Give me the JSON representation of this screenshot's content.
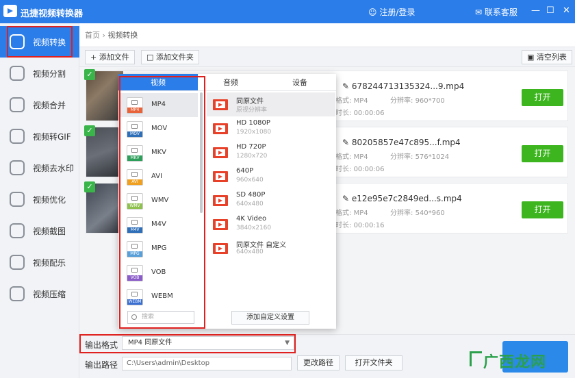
{
  "app": {
    "title": "迅捷视频转换器",
    "login": "注册/登录",
    "service": "联系客服",
    "win_min": "—",
    "win_max": "☐",
    "win_close": "✕"
  },
  "sidebar": {
    "items": [
      {
        "label": "视频转换",
        "icon": "convert-icon",
        "active": true
      },
      {
        "label": "视频分割",
        "icon": "split-icon"
      },
      {
        "label": "视频合并",
        "icon": "merge-icon"
      },
      {
        "label": "视频转GIF",
        "icon": "gif-icon"
      },
      {
        "label": "视频去水印",
        "icon": "watermark-remove-icon"
      },
      {
        "label": "视频优化",
        "icon": "optimize-icon"
      },
      {
        "label": "视频截图",
        "icon": "screenshot-icon"
      },
      {
        "label": "视频配乐",
        "icon": "music-icon"
      },
      {
        "label": "视频压缩",
        "icon": "compress-icon"
      }
    ]
  },
  "breadcrumb": {
    "home": "首页",
    "sep": "›",
    "current": "视频转换"
  },
  "toolbar": {
    "add_file": "+ 添加文件",
    "add_folder": "添加文件夹",
    "clear": "清空列表"
  },
  "files": [
    {
      "name": "678244713135324...9.mp4",
      "format_label": "格式:",
      "format": "MP4",
      "res_label": "分辨率:",
      "res": "960*700",
      "dur_label": "时长:",
      "dur": "00:00:06",
      "open": "打开"
    },
    {
      "name": "80205857e47c895...f.mp4",
      "format_label": "格式:",
      "format": "MP4",
      "res_label": "分辨率:",
      "res": "576*1024",
      "dur_label": "时长:",
      "dur": "00:00:06",
      "open": "打开"
    },
    {
      "name": "e12e95e7c2849ed...s.mp4",
      "format_label": "格式:",
      "format": "MP4",
      "res_label": "分辨率:",
      "res": "540*960",
      "dur_label": "时长:",
      "dur": "00:00:16",
      "open": "打开"
    }
  ],
  "popup": {
    "tabs": [
      "视频",
      "音频",
      "设备"
    ],
    "formats": [
      {
        "label": "MP4",
        "color": "#e8633a"
      },
      {
        "label": "MOV",
        "color": "#2f6fb8"
      },
      {
        "label": "MKV",
        "color": "#2e9e5b"
      },
      {
        "label": "AVI",
        "color": "#f0a020"
      },
      {
        "label": "WMV",
        "color": "#8fc150"
      },
      {
        "label": "M4V",
        "color": "#2f6fb8"
      },
      {
        "label": "MPG",
        "color": "#5aa0d8"
      },
      {
        "label": "VOB",
        "color": "#8a5cc8"
      },
      {
        "label": "WEBM",
        "color": "#3b6fd0"
      }
    ],
    "search_placeholder": "搜索",
    "qualities": [
      {
        "name": "同原文件",
        "res": "原视分辨率"
      },
      {
        "name": "HD 1080P",
        "res": "1920x1080"
      },
      {
        "name": "HD 720P",
        "res": "1280x720"
      },
      {
        "name": "640P",
        "res": "960x640"
      },
      {
        "name": "SD 480P",
        "res": "640x480"
      },
      {
        "name": "4K Video",
        "res": "3840x2160"
      },
      {
        "name": "同原文件 自定义",
        "res": "640x480"
      }
    ],
    "add_custom": "添加自定义设置"
  },
  "bottom": {
    "format_label": "输出格式",
    "format_value": "MP4  同原文件",
    "path_label": "输出路径",
    "path_value": "C:\\Users\\admin\\Desktop",
    "change_path": "更改路径",
    "open_folder": "打开文件夹"
  },
  "watermark": "广西龙网",
  "colors": {
    "accent": "#2b7de9",
    "open_button": "#3cb51f",
    "highlight": "#e0201e"
  }
}
